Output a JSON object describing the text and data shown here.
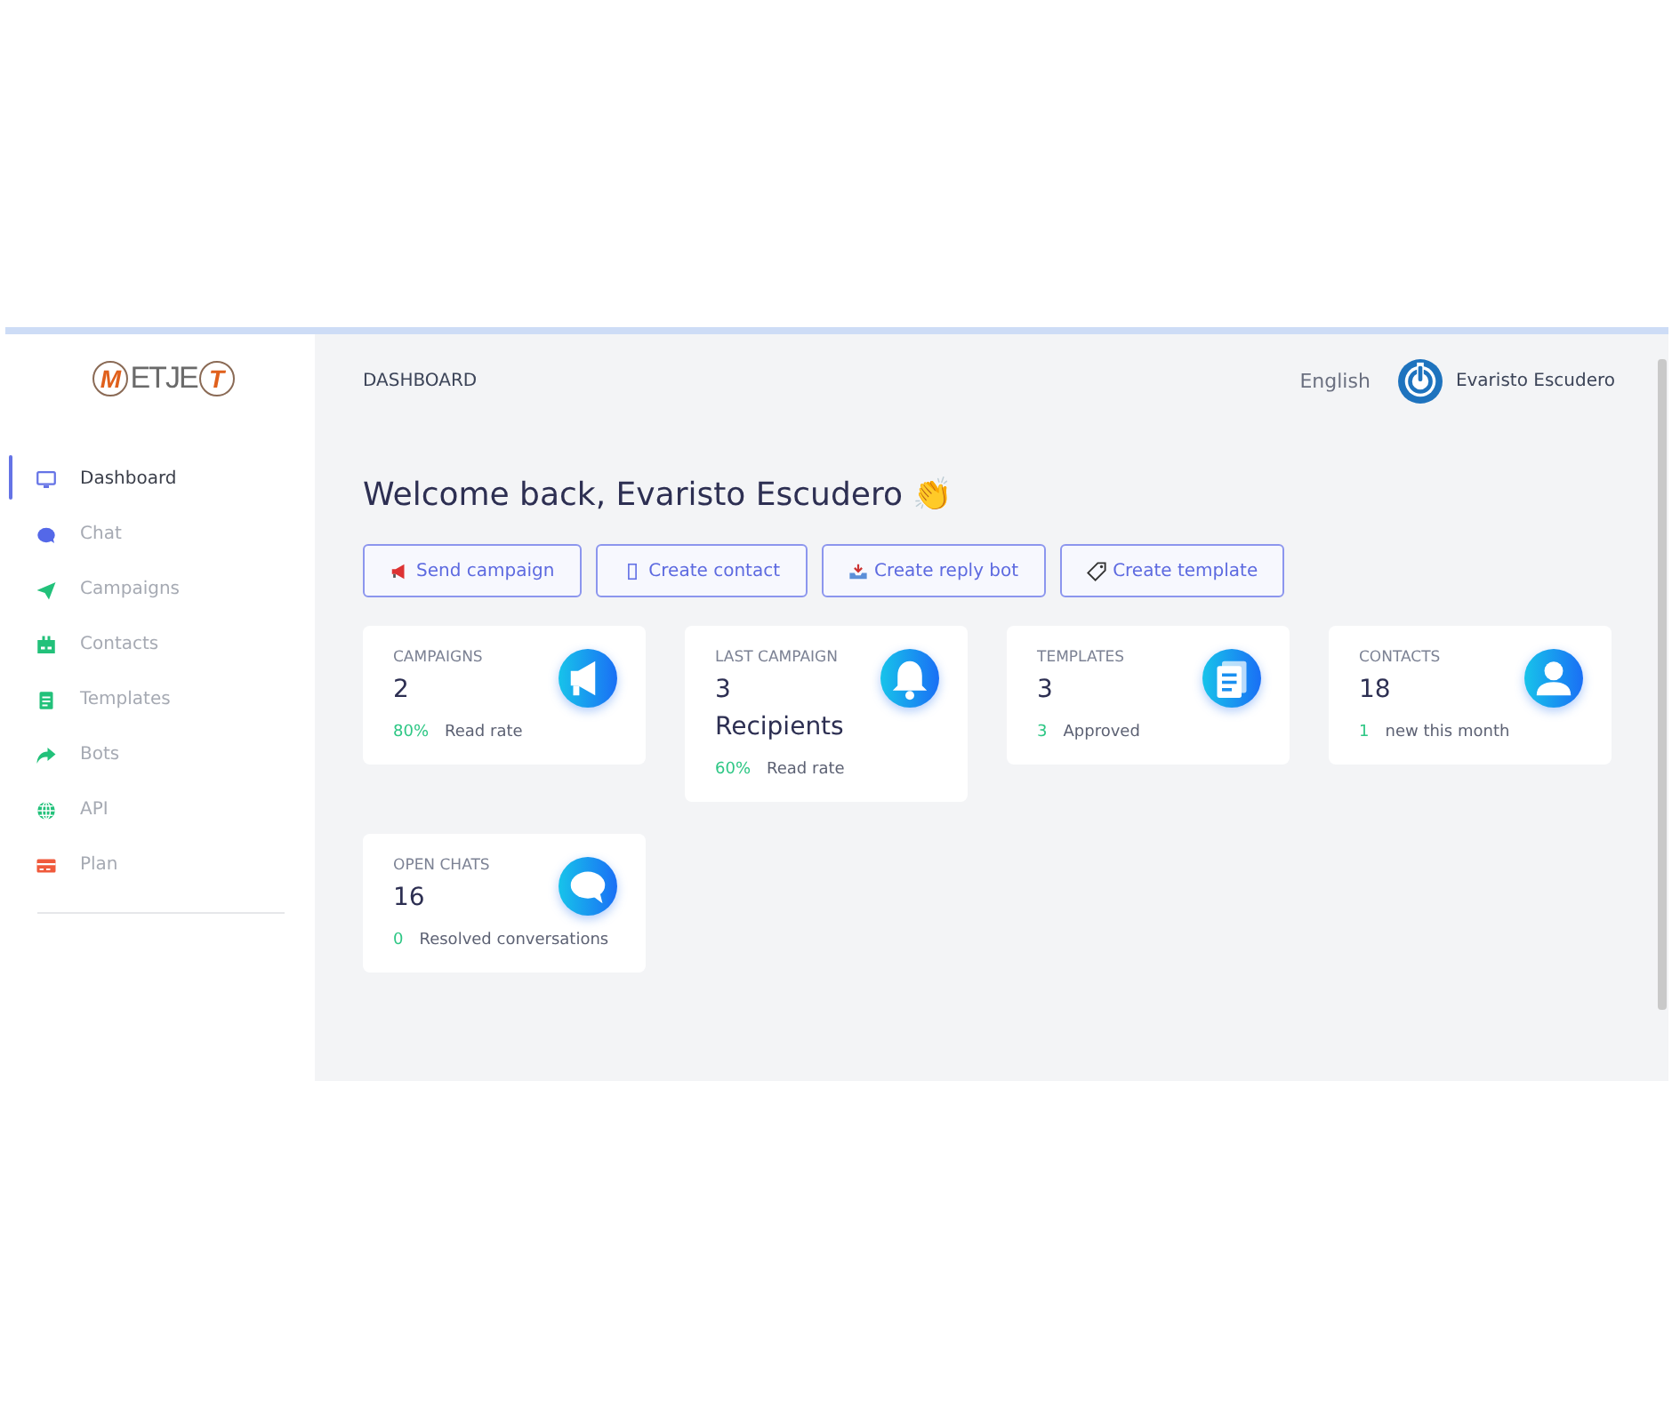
{
  "logo": {
    "parts": [
      {
        "text": "M",
        "circled": true
      },
      {
        "text": "ETJE",
        "circled": false
      },
      {
        "text": "T",
        "circled": true
      }
    ]
  },
  "sidebar": {
    "items": [
      {
        "label": "Dashboard",
        "kind": "monitor",
        "selected": true
      },
      {
        "label": "Chat",
        "kind": "chat",
        "selected": false
      },
      {
        "label": "Campaigns",
        "kind": "send",
        "selected": false
      },
      {
        "label": "Contacts",
        "kind": "contacts",
        "selected": false
      },
      {
        "label": "Templates",
        "kind": "document",
        "selected": false
      },
      {
        "label": "Bots",
        "kind": "share",
        "selected": false
      },
      {
        "label": "API",
        "kind": "globe",
        "selected": false
      },
      {
        "label": "Plan",
        "kind": "card",
        "selected": false
      }
    ]
  },
  "header": {
    "title": "DASHBOARD",
    "language": "English",
    "user": "Evaristo Escudero"
  },
  "welcome": "Welcome back, Evaristo Escudero 👏",
  "actions": [
    {
      "label": "Send campaign",
      "kind": "megaphone"
    },
    {
      "label": "Create contact",
      "kind": "box"
    },
    {
      "label": "Create reply bot",
      "kind": "tray"
    },
    {
      "label": "Create template",
      "kind": "tag"
    }
  ],
  "cards": [
    {
      "title": "CAMPAIGNS",
      "value": "2",
      "stat": "80%",
      "note": "Read rate",
      "kind": "megaphone"
    },
    {
      "title": "LAST CAMPAIGN",
      "value": "3\nRecipients",
      "stat": "60%",
      "note": "Read rate",
      "kind": "bell"
    },
    {
      "title": "TEMPLATES",
      "value": "3",
      "stat": "3",
      "note": "Approved",
      "kind": "document"
    },
    {
      "title": "CONTACTS",
      "value": "18",
      "stat": "1",
      "note": "new this month",
      "kind": "person"
    },
    {
      "title": "OPEN CHATS",
      "value": "16",
      "stat": "0",
      "note": "Resolved conversations",
      "kind": "chat"
    }
  ]
}
